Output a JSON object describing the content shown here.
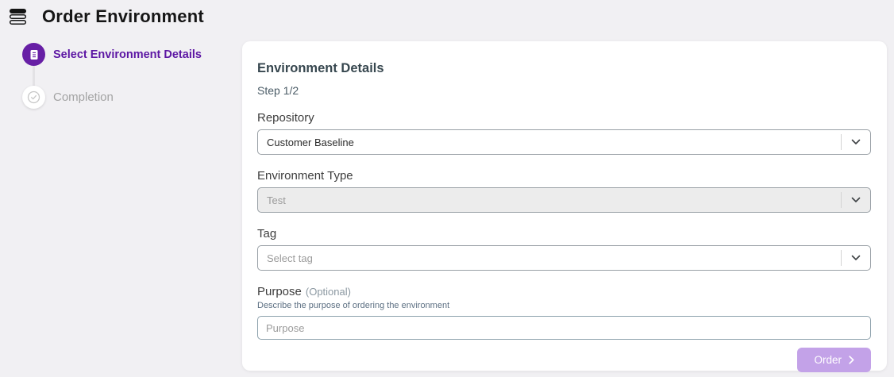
{
  "header": {
    "title": "Order Environment",
    "icon": "stack-menu-icon"
  },
  "stepper": {
    "steps": [
      {
        "label": "Select Environment Details",
        "state": "active",
        "icon": "document-icon"
      },
      {
        "label": "Completion",
        "state": "pending",
        "icon": "check-circle-icon"
      }
    ]
  },
  "card": {
    "title": "Environment Details",
    "step_indicator": "Step 1/2",
    "fields": {
      "repository": {
        "label": "Repository",
        "value": "Customer Baseline"
      },
      "environment_type": {
        "label": "Environment Type",
        "value": "Test",
        "disabled": true
      },
      "tag": {
        "label": "Tag",
        "placeholder": "Select tag"
      },
      "purpose": {
        "label": "Purpose",
        "optional_note": "(Optional)",
        "helper": "Describe the purpose of ordering the environment",
        "placeholder": "Purpose"
      }
    },
    "order_button": {
      "label": "Order",
      "disabled": true
    }
  },
  "colors": {
    "accent_purple": "#671fa5",
    "active_label_purple": "#5c16a3",
    "order_button_bg": "#c3a2e8",
    "disabled_field_bg": "#ececec",
    "page_bg": "#f1f0f3"
  }
}
